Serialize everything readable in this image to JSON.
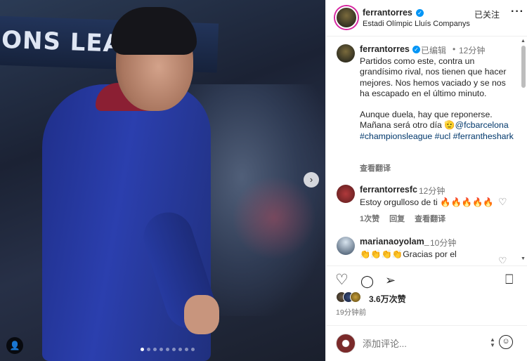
{
  "header": {
    "username": "ferrantorres",
    "verified_mark": "✓",
    "location": "Estadi Olímpic Lluís Companys",
    "follow_label": "已关注",
    "more_label": "···"
  },
  "media": {
    "banner_text": "ONS LEAGUE",
    "next_label": "›",
    "user_tag_label": "👤",
    "carousel_count": 9,
    "carousel_active": 0
  },
  "caption": {
    "username": "ferrantorres",
    "edited_label": "已编辑",
    "dot": "•",
    "time": "12分钟",
    "paragraph1": "Partidos como este, contra un grandísimo rival, nos tienen que hacer mejores. Nos hemos vaciado y se nos ha escapado en el último minuto.",
    "line2a": "Aunque duela, hay que reponerse.",
    "line2b": "Mañana será otro día ",
    "mention": "🫡@fcbarcelona",
    "hashtags": "#championsleague #ucl #ferrantheshark",
    "translate_label": "查看翻译"
  },
  "comments": [
    {
      "username": "ferrantorresfc",
      "time": "12分钟",
      "text": "Estoy orgulloso de ti 🔥🔥🔥🔥🔥",
      "likes": "1次赞",
      "reply": "回复",
      "translate": "查看翻译"
    },
    {
      "username": "marianaoyolam_",
      "time": "10分钟",
      "text": "👏👏👏👏Gracias por el"
    }
  ],
  "actions": {
    "like_icon": "♡",
    "comment_icon": "◯",
    "share_icon": "➢",
    "save_icon": "⎕"
  },
  "likes_label": "3.6万次赞",
  "post_time": "19分钟前",
  "comment_box": {
    "placeholder": "添加评论...",
    "emoji_icon": "☺"
  }
}
